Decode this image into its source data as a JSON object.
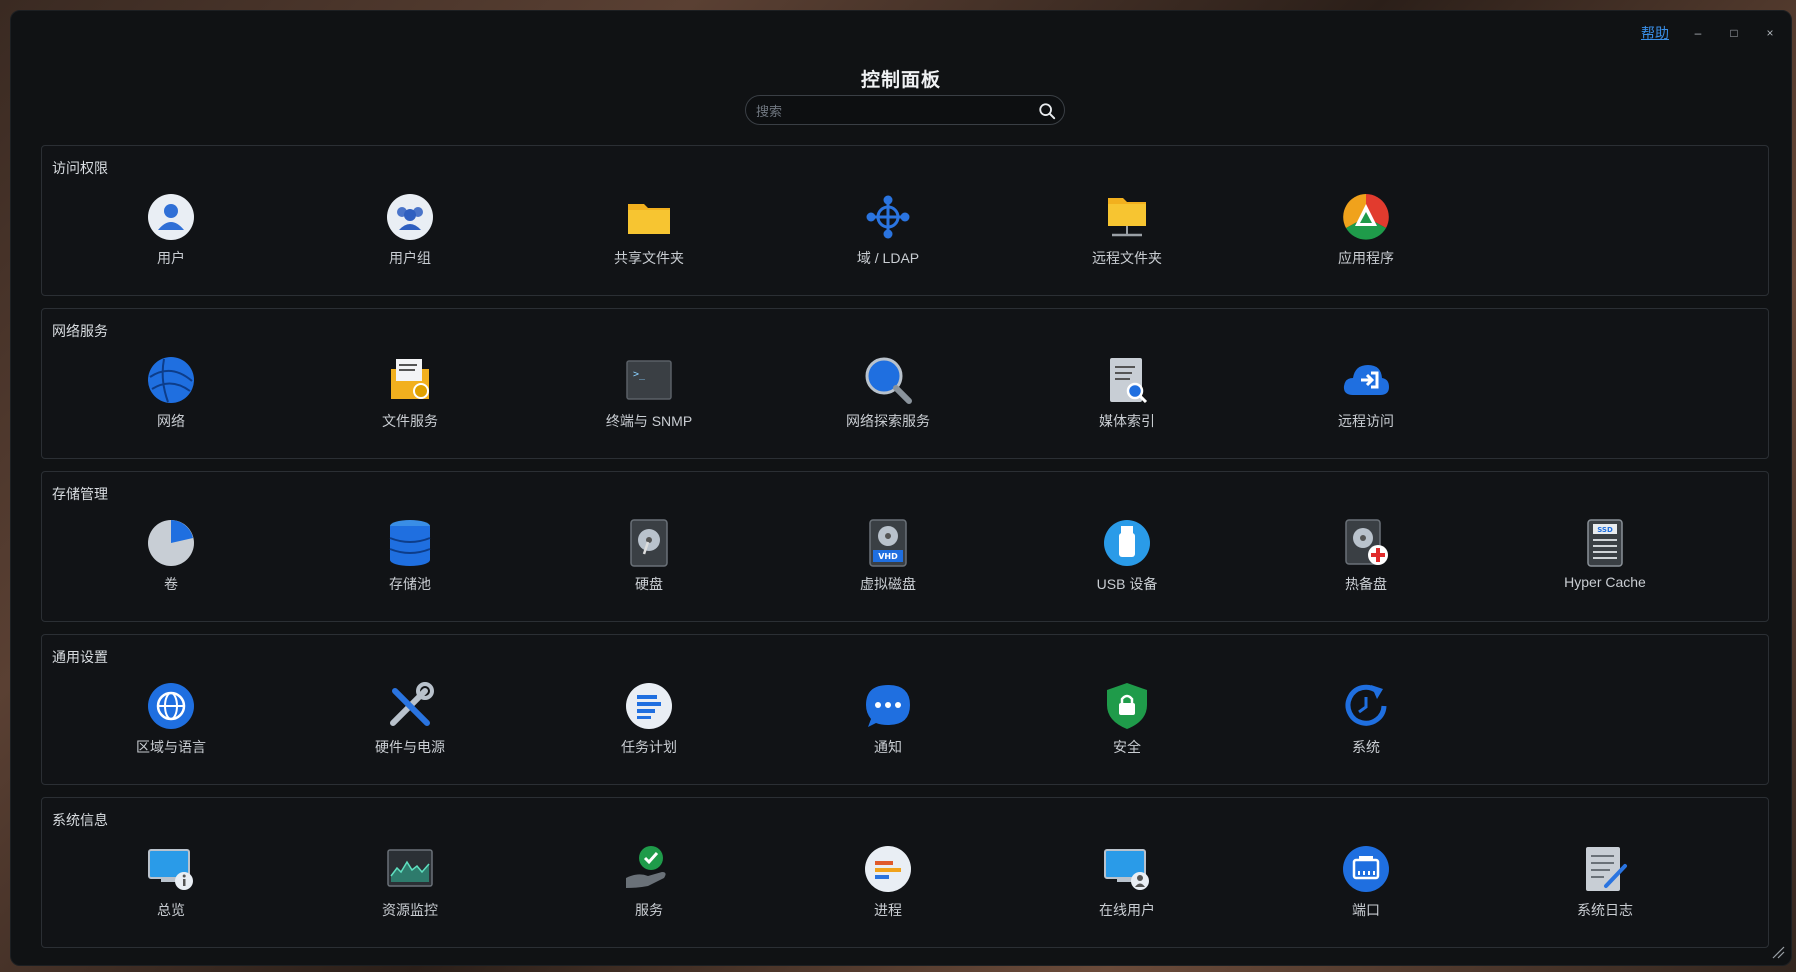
{
  "header": {
    "title": "控制面板",
    "help": "帮助",
    "minimize": "–",
    "maximize": "□",
    "close": "×"
  },
  "search": {
    "placeholder": "搜索",
    "value": ""
  },
  "sections": [
    {
      "title": "访问权限",
      "items": [
        "用户",
        "用户组",
        "共享文件夹",
        "域 / LDAP",
        "远程文件夹",
        "应用程序"
      ]
    },
    {
      "title": "网络服务",
      "items": [
        "网络",
        "文件服务",
        "终端与 SNMP",
        "网络探索服务",
        "媒体索引",
        "远程访问"
      ]
    },
    {
      "title": "存储管理",
      "items": [
        "卷",
        "存储池",
        "硬盘",
        "虚拟磁盘",
        "USB 设备",
        "热备盘",
        "Hyper Cache"
      ]
    },
    {
      "title": "通用设置",
      "items": [
        "区域与语言",
        "硬件与电源",
        "任务计划",
        "通知",
        "安全",
        "系统"
      ]
    },
    {
      "title": "系统信息",
      "items": [
        "总览",
        "资源监控",
        "服务",
        "进程",
        "在线用户",
        "端口",
        "系统日志"
      ]
    }
  ]
}
